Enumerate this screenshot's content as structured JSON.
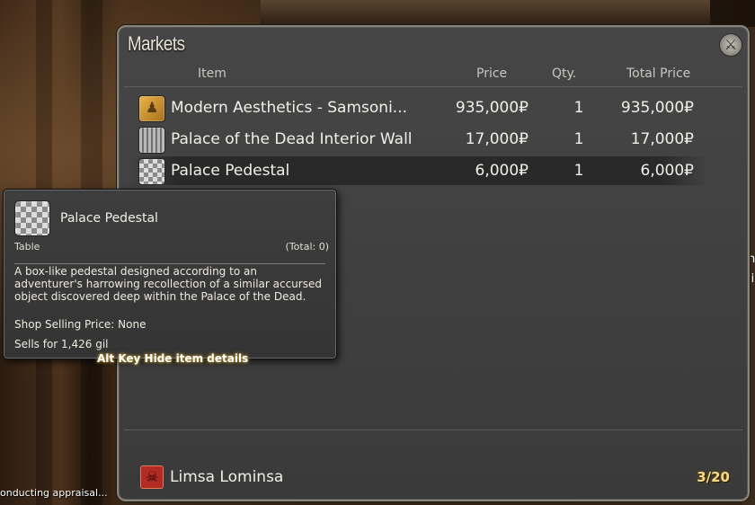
{
  "window": {
    "title": "Markets",
    "close_icon": "⚔",
    "columns": {
      "item": "Item",
      "price": "Price",
      "qty": "Qty.",
      "total": "Total Price"
    }
  },
  "listings": [
    {
      "icon": "gold-figure-icon",
      "name": "Modern Aesthetics - Samsoni...",
      "price": "935,000₽",
      "qty": "1",
      "total": "935,000₽"
    },
    {
      "icon": "interior-wall-icon",
      "name": "Palace of the Dead Interior Wall",
      "price": "17,000₽",
      "qty": "1",
      "total": "17,000₽"
    },
    {
      "icon": "pedestal-icon",
      "name": "Palace Pedestal",
      "price": "6,000₽",
      "qty": "1",
      "total": "6,000₽",
      "selected": true
    }
  ],
  "tooltip": {
    "name": "Palace Pedestal",
    "type": "Table",
    "total": "(Total: 0)",
    "description": "A box-like pedestal designed according to an adventurer's harrowing recollection of a similar accursed object discovered deep within the Palace of the Dead.",
    "shop_price": "Shop Selling Price: None",
    "sells_for": "Sells for 1,426 gil"
  },
  "hint": "Alt Key  Hide item details",
  "location": {
    "name": "Limsa Lominsa",
    "icon": "limsa-crest-icon"
  },
  "page_count": "3/20",
  "status": "onducting appraisal...",
  "right_edge": [
    "n",
    "li"
  ],
  "colors": {
    "accent_gold": "#f5d98a",
    "window_bg": "#3a3a3a",
    "crest_red": "#b42a24"
  }
}
